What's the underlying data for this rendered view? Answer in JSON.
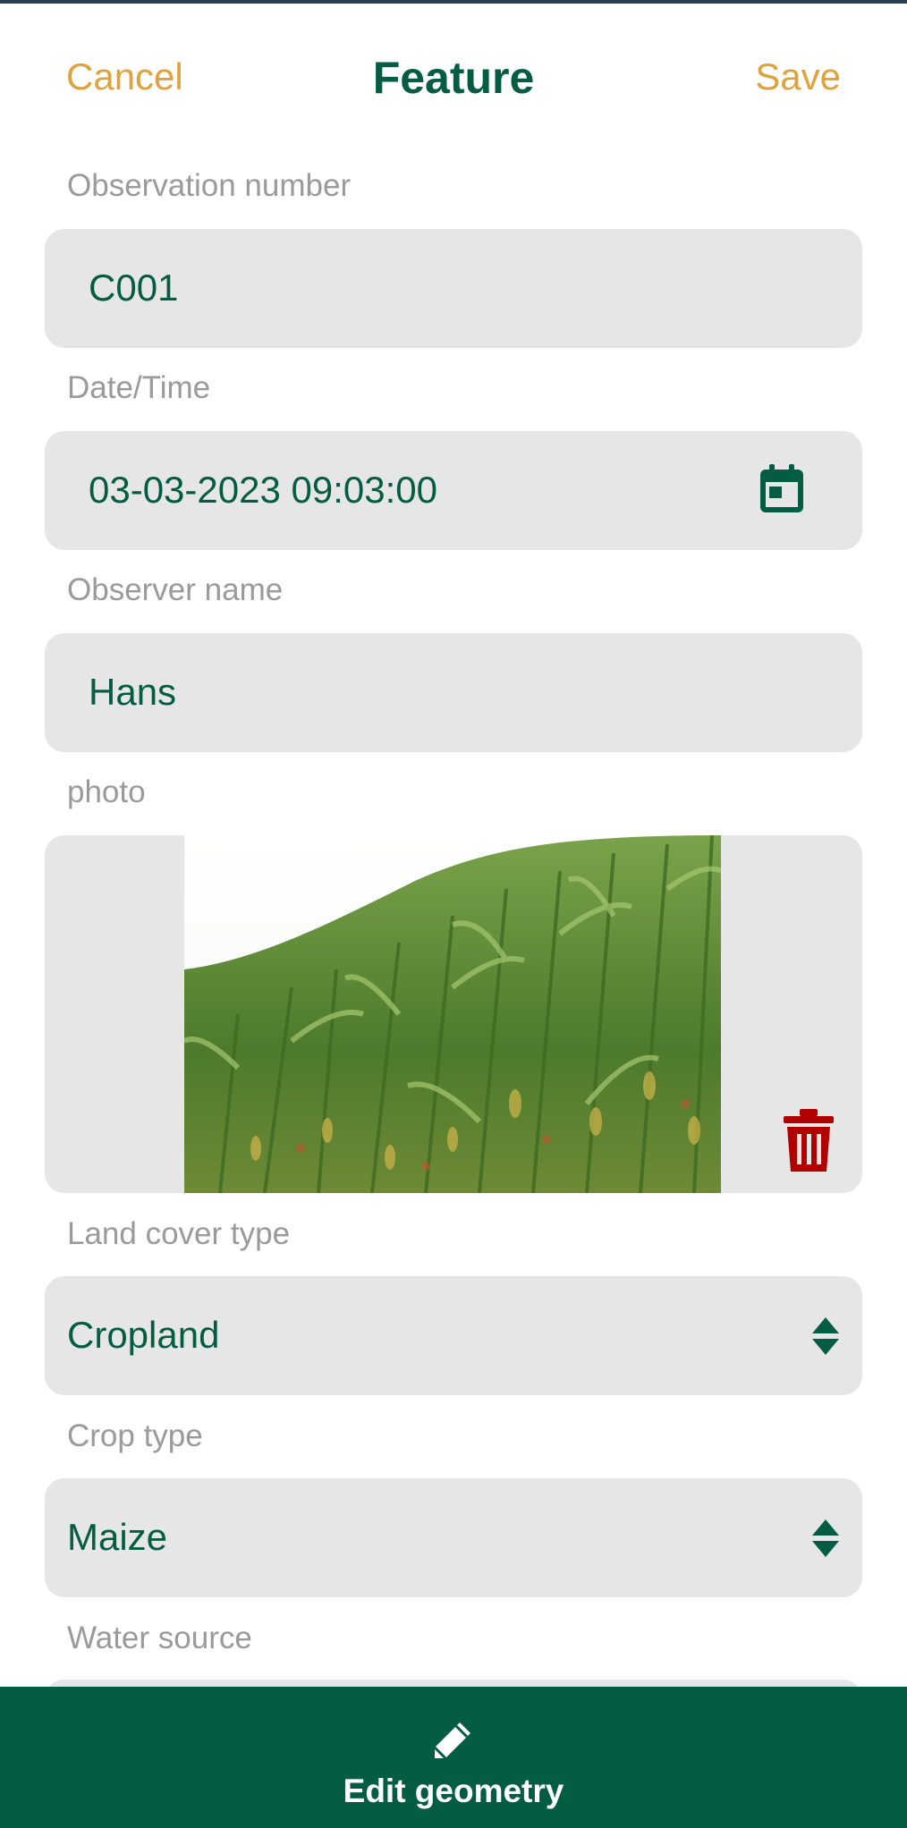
{
  "header": {
    "cancel_label": "Cancel",
    "title": "Feature",
    "save_label": "Save"
  },
  "form": {
    "observation_number": {
      "label": "Observation number",
      "value": "C001"
    },
    "datetime": {
      "label": "Date/Time",
      "value": "03-03-2023 09:03:00",
      "icon": "calendar-icon"
    },
    "observer_name": {
      "label": "Observer name",
      "value": "Hans"
    },
    "photo": {
      "label": "photo",
      "delete_icon": "trash-icon"
    },
    "land_cover_type": {
      "label": "Land cover type",
      "value": "Cropland",
      "icon": "updown-icon"
    },
    "crop_type": {
      "label": "Crop type",
      "value": "Maize",
      "icon": "updown-icon"
    },
    "water_source": {
      "label": "Water source"
    }
  },
  "bottom_bar": {
    "icon": "pencil-icon",
    "label": "Edit geometry"
  },
  "colors": {
    "accent_green": "#045d43",
    "cancel_save_orange": "#e0a23c",
    "label_gray": "#9a9a9a",
    "field_bg": "#e6e6e6",
    "trash_red": "#b00000"
  }
}
